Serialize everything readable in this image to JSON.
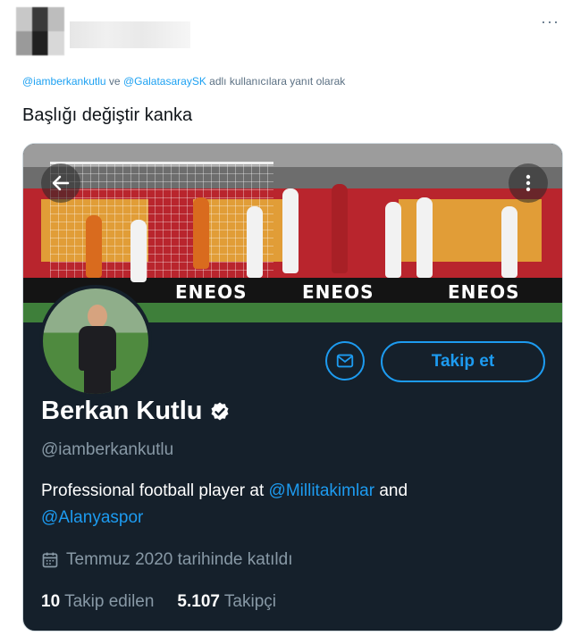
{
  "tweet": {
    "more_label": "···",
    "reply_to": {
      "mention_1": "@iamberkankutlu",
      "connector": "ve",
      "mention_2": "@GalatasaraySK",
      "suffix": "adlı kullanıcılara yanıt olarak"
    },
    "text": "Başlığı değiştir kanka"
  },
  "profile": {
    "banner_ads": [
      "ENEOS",
      "ENEOS",
      "ENEOS"
    ],
    "name": "Berkan Kutlu",
    "handle": "@iamberkankutlu",
    "bio": {
      "prefix": "Professional football player at ",
      "link_1": "@Millitakimlar",
      "middle": " and",
      "link_2": "@Alanyaspor"
    },
    "joined": "Temmuz 2020 tarihinde katıldı",
    "following_count": "10",
    "following_label": "Takip edilen",
    "followers_count": "5.107",
    "followers_label": "Takipçi",
    "follow_button": "Takip et"
  },
  "colors": {
    "card_bg": "#15202b",
    "accent": "#1d9bf0",
    "muted": "#8899a6"
  },
  "icons": [
    "back-arrow-icon",
    "more-vertical-icon",
    "mail-icon",
    "verified-badge-icon",
    "calendar-icon"
  ]
}
